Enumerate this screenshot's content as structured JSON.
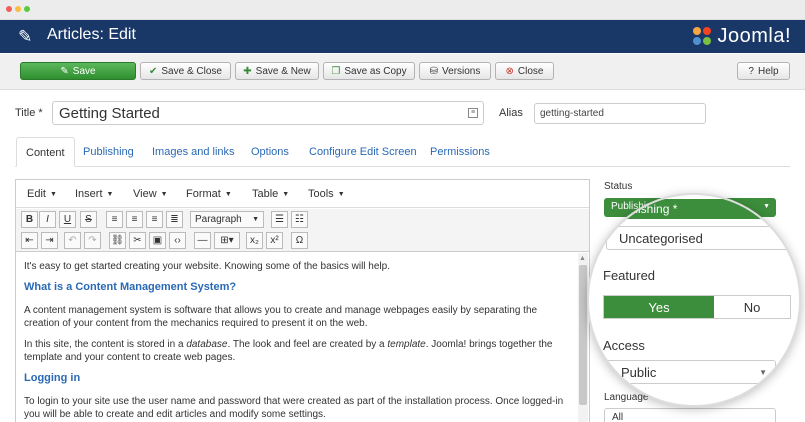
{
  "header": {
    "title": "Articles: Edit",
    "brand": "Joomla!"
  },
  "toolbar": {
    "save": "Save",
    "save_close": "Save & Close",
    "save_new": "Save & New",
    "save_copy": "Save as Copy",
    "versions": "Versions",
    "close": "Close",
    "help": "Help"
  },
  "form": {
    "title_label": "Title *",
    "title_value": "Getting Started",
    "alias_label": "Alias",
    "alias_value": "getting-started"
  },
  "tabs": [
    "Content",
    "Publishing",
    "Images and links",
    "Options",
    "Configure Edit Screen",
    "Permissions"
  ],
  "editor": {
    "menus": [
      "Edit",
      "Insert",
      "View",
      "Format",
      "Table",
      "Tools"
    ],
    "format_select": "Paragraph",
    "content": {
      "p1": "It's easy to get started creating your website. Knowing some of the basics will help.",
      "h1": "What is a Content Management System?",
      "p2": "A content management system is software that allows you to create and manage webpages easily by separating the creation of your content from the mechanics required to present it on the web.",
      "p3a": "In this site, the content is stored in a ",
      "p3b": "database",
      "p3c": ". The look and feel are created by a ",
      "p3d": "template",
      "p3e": ". Joomla! brings together the template and your content to create web pages.",
      "h2": "Logging in",
      "p4": "To login to your site use the user name and password that were created as part of the installation process. Once logged-in you will be able to create and edit articles and modify some settings."
    }
  },
  "sidebar": {
    "status_label": "Status",
    "status_value": "Publishing *",
    "category_value": "Uncategorised",
    "featured_label": "Featured",
    "featured_yes": "Yes",
    "featured_no": "No",
    "access_label": "Access",
    "access_value": "Public",
    "language_label": "Language",
    "language_value": "All"
  },
  "colors": {
    "header": "#1a3867",
    "save": "#3c8d3c",
    "link": "#2a69b5"
  }
}
